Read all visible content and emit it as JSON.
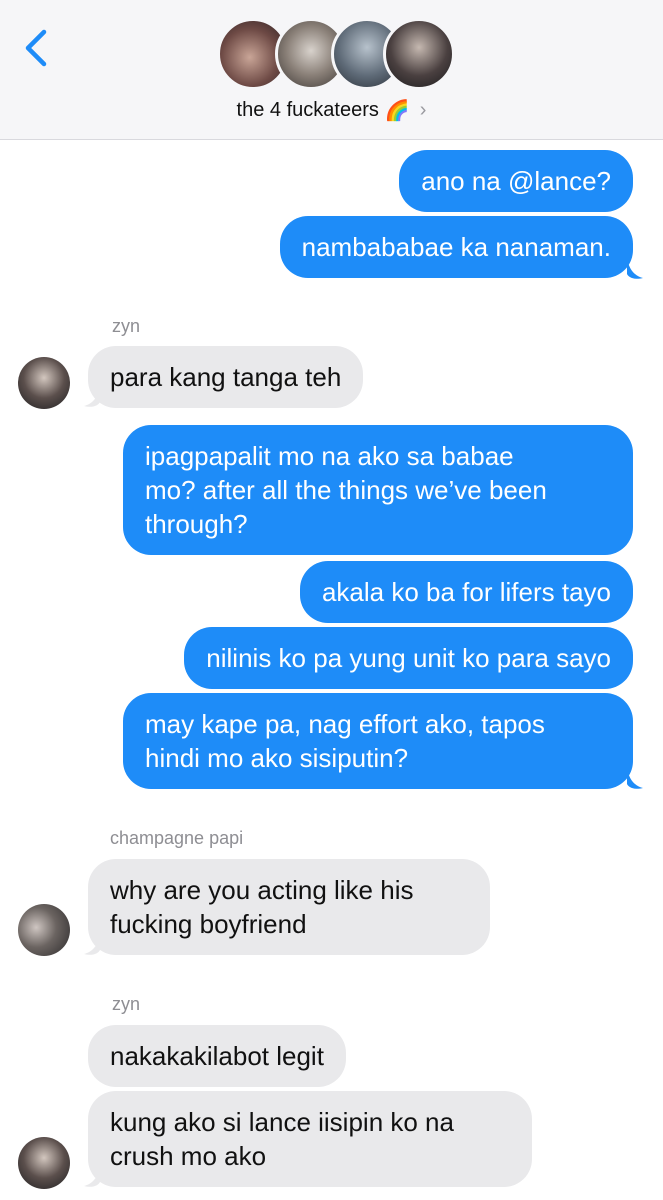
{
  "header": {
    "group_name": "the 4 fuckateers",
    "emoji": "🌈",
    "chevron": "›"
  },
  "colors": {
    "outgoing": "#1e8cf8",
    "incoming": "#e9e9eb",
    "accent": "#1e8cf8"
  },
  "messages": [
    {
      "type": "out",
      "text": "ano na @lance?"
    },
    {
      "type": "out",
      "text": "nambababae ka nanaman."
    },
    {
      "type": "name",
      "text": "zyn"
    },
    {
      "type": "in",
      "text": "para kang tanga teh"
    },
    {
      "type": "out",
      "lines": [
        "ipagpapalit mo na ako sa babae",
        "mo? after all the things we’ve been",
        "through?"
      ]
    },
    {
      "type": "out",
      "text": "akala ko ba for lifers tayo"
    },
    {
      "type": "out",
      "text": "nilinis ko pa yung unit ko para sayo"
    },
    {
      "type": "out",
      "lines": [
        "may kape pa, nag effort ako, tapos",
        "hindi mo ako sisiputin?"
      ]
    },
    {
      "type": "name",
      "text": "champagne papi"
    },
    {
      "type": "in",
      "lines": [
        "why are you acting like his",
        "fucking boyfriend"
      ]
    },
    {
      "type": "name",
      "text": "zyn"
    },
    {
      "type": "in",
      "text": "nakakakilabot legit"
    },
    {
      "type": "in",
      "lines": [
        "kung ako si lance iisipin ko na",
        "crush mo ako"
      ]
    }
  ]
}
